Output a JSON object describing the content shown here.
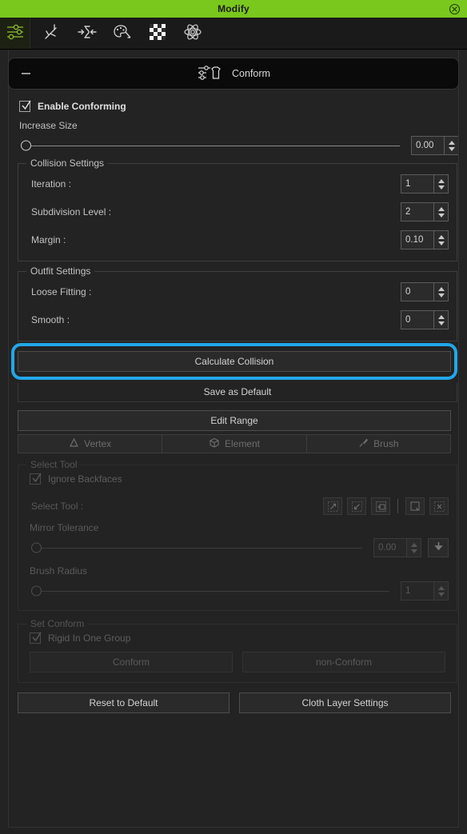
{
  "window": {
    "title": "Modify",
    "close_icon": "close-circle-icon"
  },
  "toolbar": {
    "active_icon": "sliders-icon",
    "items": [
      {
        "icon": "pose-figure-icon",
        "label": "Pose"
      },
      {
        "icon": "scale-inward-icon",
        "label": "Scale"
      },
      {
        "icon": "palette-icon",
        "label": "Material"
      },
      {
        "icon": "checker-texture-icon",
        "label": "Texture"
      },
      {
        "icon": "atom-physics-icon",
        "label": "Physics"
      }
    ]
  },
  "conform_panel": {
    "collapse_icon": "minus-icon",
    "header_icon": "conform-sliders-shirt-icon",
    "header_label": "Conform",
    "enable_conforming": {
      "label": "Enable Conforming",
      "checked": true
    },
    "increase_size": {
      "label": "Increase Size",
      "value": "0.00",
      "slider_percent": 0
    },
    "collision_settings": {
      "legend": "Collision Settings",
      "rows": [
        {
          "name": "Iteration :",
          "value": "1"
        },
        {
          "name": "Subdivision Level :",
          "value": "2"
        },
        {
          "name": "Margin :",
          "value": "0.10"
        }
      ]
    },
    "outfit_settings": {
      "legend": "Outfit Settings",
      "rows": [
        {
          "name": "Loose Fitting :",
          "value": "0"
        },
        {
          "name": "Smooth :",
          "value": "0"
        }
      ]
    },
    "calculate_collision": {
      "label": "Calculate Collision",
      "highlight_color": "#22a7e8"
    },
    "save_as_default": {
      "label": "Save as Default"
    }
  },
  "edit_range": {
    "button_label": "Edit Range",
    "tabs": [
      {
        "label": "Vertex",
        "icon": "triangle-vertex-icon",
        "enabled": false
      },
      {
        "label": "Element",
        "icon": "cube-element-icon",
        "enabled": false
      },
      {
        "label": "Brush",
        "icon": "brush-icon",
        "enabled": false
      }
    ]
  },
  "select_tool_group": {
    "legend": "Select Tool",
    "ignore_backfaces": {
      "label": "Ignore Backfaces",
      "checked": true
    },
    "select_tool_label": "Select Tool :",
    "tool_icons": [
      "select-expand-icon",
      "select-shrink-icon",
      "select-invert-icon",
      "select-rect-icon",
      "select-clear-icon"
    ],
    "mirror_tolerance": {
      "label": "Mirror Tolerance",
      "value": "0.00",
      "slider_percent": 0,
      "apply_icon": "arrow-down-icon"
    },
    "brush_radius": {
      "label": "Brush Radius",
      "value": "1",
      "slider_percent": 0
    }
  },
  "set_conform_group": {
    "legend": "Set Conform",
    "rigid_in_one_group": {
      "label": "Rigid In One Group",
      "checked": true
    },
    "conform_button": "Conform",
    "non_conform_button": "non-Conform"
  },
  "footer": {
    "reset_to_default": "Reset to Default",
    "cloth_layer_settings": "Cloth Layer Settings"
  }
}
